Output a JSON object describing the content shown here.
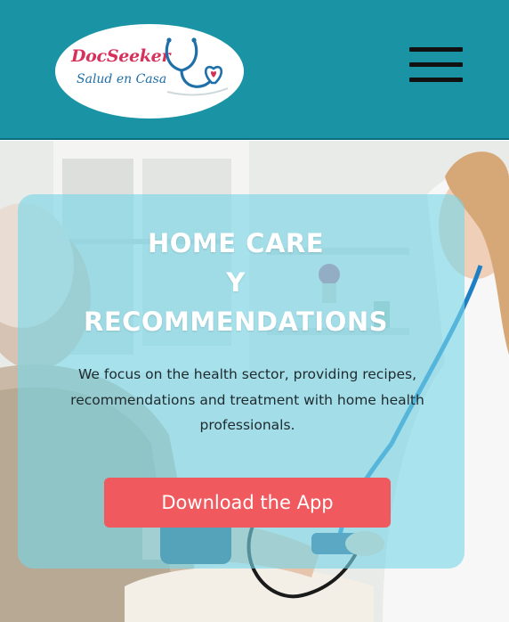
{
  "header": {
    "logo": {
      "title": "DocSeeker",
      "subtitle": "Salud en Casa"
    },
    "menu_icon": "hamburger-menu-icon"
  },
  "hero": {
    "headline": [
      "HOME CARE",
      "Y",
      "RECOMMENDATIONS"
    ],
    "description": "We focus on the health sector, providing recipes, recommendations and treatment with home health professionals.",
    "cta_label": "Download the App",
    "image": "photo-doctor-with-elderly-patient"
  },
  "colors": {
    "header_bg": "#1a93a4",
    "overlay": "#78d6e8",
    "cta_bg": "#f05a5f",
    "logo_red": "#d6315b",
    "logo_blue": "#1f6fa8"
  }
}
